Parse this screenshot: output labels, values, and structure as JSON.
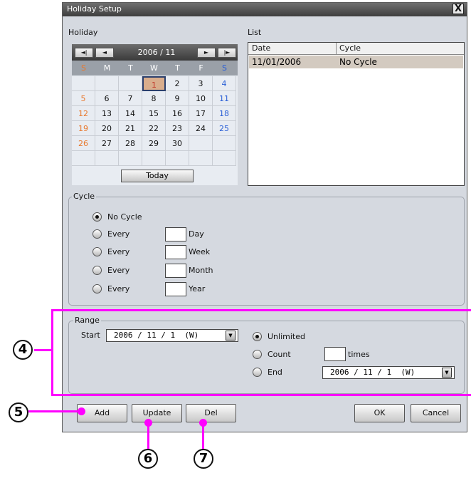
{
  "window": {
    "title": "Holiday Setup",
    "close_glyph": "X"
  },
  "holiday": {
    "label": "Holiday",
    "calendar": {
      "month_label": "2006 / 11",
      "nav": {
        "first": "◄|",
        "prev": "◄",
        "next": "►",
        "last": "|►"
      },
      "weekdays": [
        "S",
        "M",
        "T",
        "W",
        "T",
        "F",
        "S"
      ],
      "weeks": [
        [
          "",
          "",
          "",
          "1",
          "2",
          "3",
          "4"
        ],
        [
          "5",
          "6",
          "7",
          "8",
          "9",
          "10",
          "11"
        ],
        [
          "12",
          "13",
          "14",
          "15",
          "16",
          "17",
          "18"
        ],
        [
          "19",
          "20",
          "21",
          "22",
          "23",
          "24",
          "25"
        ],
        [
          "26",
          "27",
          "28",
          "29",
          "30",
          "",
          ""
        ],
        [
          "",
          "",
          "",
          "",
          "",
          "",
          ""
        ]
      ],
      "selected_day": "1",
      "today_button": "Today"
    }
  },
  "list": {
    "label": "List",
    "columns": [
      "Date",
      "Cycle"
    ],
    "rows": [
      {
        "date": "11/01/2006",
        "cycle": "No Cycle"
      }
    ]
  },
  "cycle": {
    "legend": "Cycle",
    "no_cycle": "No Cycle",
    "options": [
      {
        "label": "Every",
        "unit": "Day"
      },
      {
        "label": "Every",
        "unit": "Week"
      },
      {
        "label": "Every",
        "unit": "Month"
      },
      {
        "label": "Every",
        "unit": "Year"
      }
    ]
  },
  "range": {
    "legend": "Range",
    "start_label": "Start",
    "start_value": "2006 / 11 / 1  (W)",
    "unlimited": "Unlimited",
    "count": "Count",
    "count_suffix": "times",
    "end": "End",
    "end_value": "2006 / 11 / 1  (W)"
  },
  "buttons": {
    "add": "Add",
    "update": "Update",
    "del": "Del",
    "ok": "OK",
    "cancel": "Cancel"
  },
  "callouts": [
    "4",
    "5",
    "6",
    "7"
  ],
  "colors": {
    "highlight": "#ff00ff",
    "sunday": "#e8782c",
    "saturday": "#2a5fd6",
    "titlebar": "#3e3e3e"
  }
}
